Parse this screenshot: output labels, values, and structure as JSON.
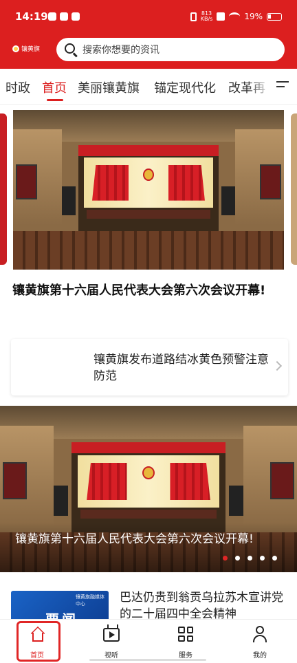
{
  "status_bar": {
    "time": "14:19",
    "network_speed_value": "813",
    "network_speed_unit": "KB/s",
    "battery": "19%"
  },
  "header": {
    "logo_text": "镶黄旗",
    "search_placeholder": "搜索你想要的资讯",
    "accent_color": "#dc1f1f"
  },
  "tabs": [
    {
      "label": "时政",
      "active": false
    },
    {
      "label": "首页",
      "active": true
    },
    {
      "label": "美丽镶黄旗",
      "active": false
    },
    {
      "label": "锚定现代化",
      "active": false
    },
    {
      "label": "改革再",
      "active": false
    }
  ],
  "hero": {
    "headline": "镶黄旗第十六届人民代表大会第六次会议开幕!"
  },
  "notice": {
    "title": "镶黄旗发布道路结冰黄色预警注意防范"
  },
  "carousel": {
    "title": "镶黄旗第十六届人民代表大会第六次会议开幕!",
    "slide_count": 5,
    "active_index": 0
  },
  "news_list": [
    {
      "thumb_brand": "镶黄旗融媒体中心",
      "thumb_text": "要闻",
      "title": "巴达仍贵到翁贡乌拉苏木宣讲党的二十届四中全会精神"
    }
  ],
  "bottom_nav": [
    {
      "label": "首页",
      "icon": "home-icon",
      "active": true
    },
    {
      "label": "视听",
      "icon": "video-icon",
      "active": false
    },
    {
      "label": "服务",
      "icon": "grid-icon",
      "active": false
    },
    {
      "label": "我的",
      "icon": "user-icon",
      "active": false
    }
  ]
}
